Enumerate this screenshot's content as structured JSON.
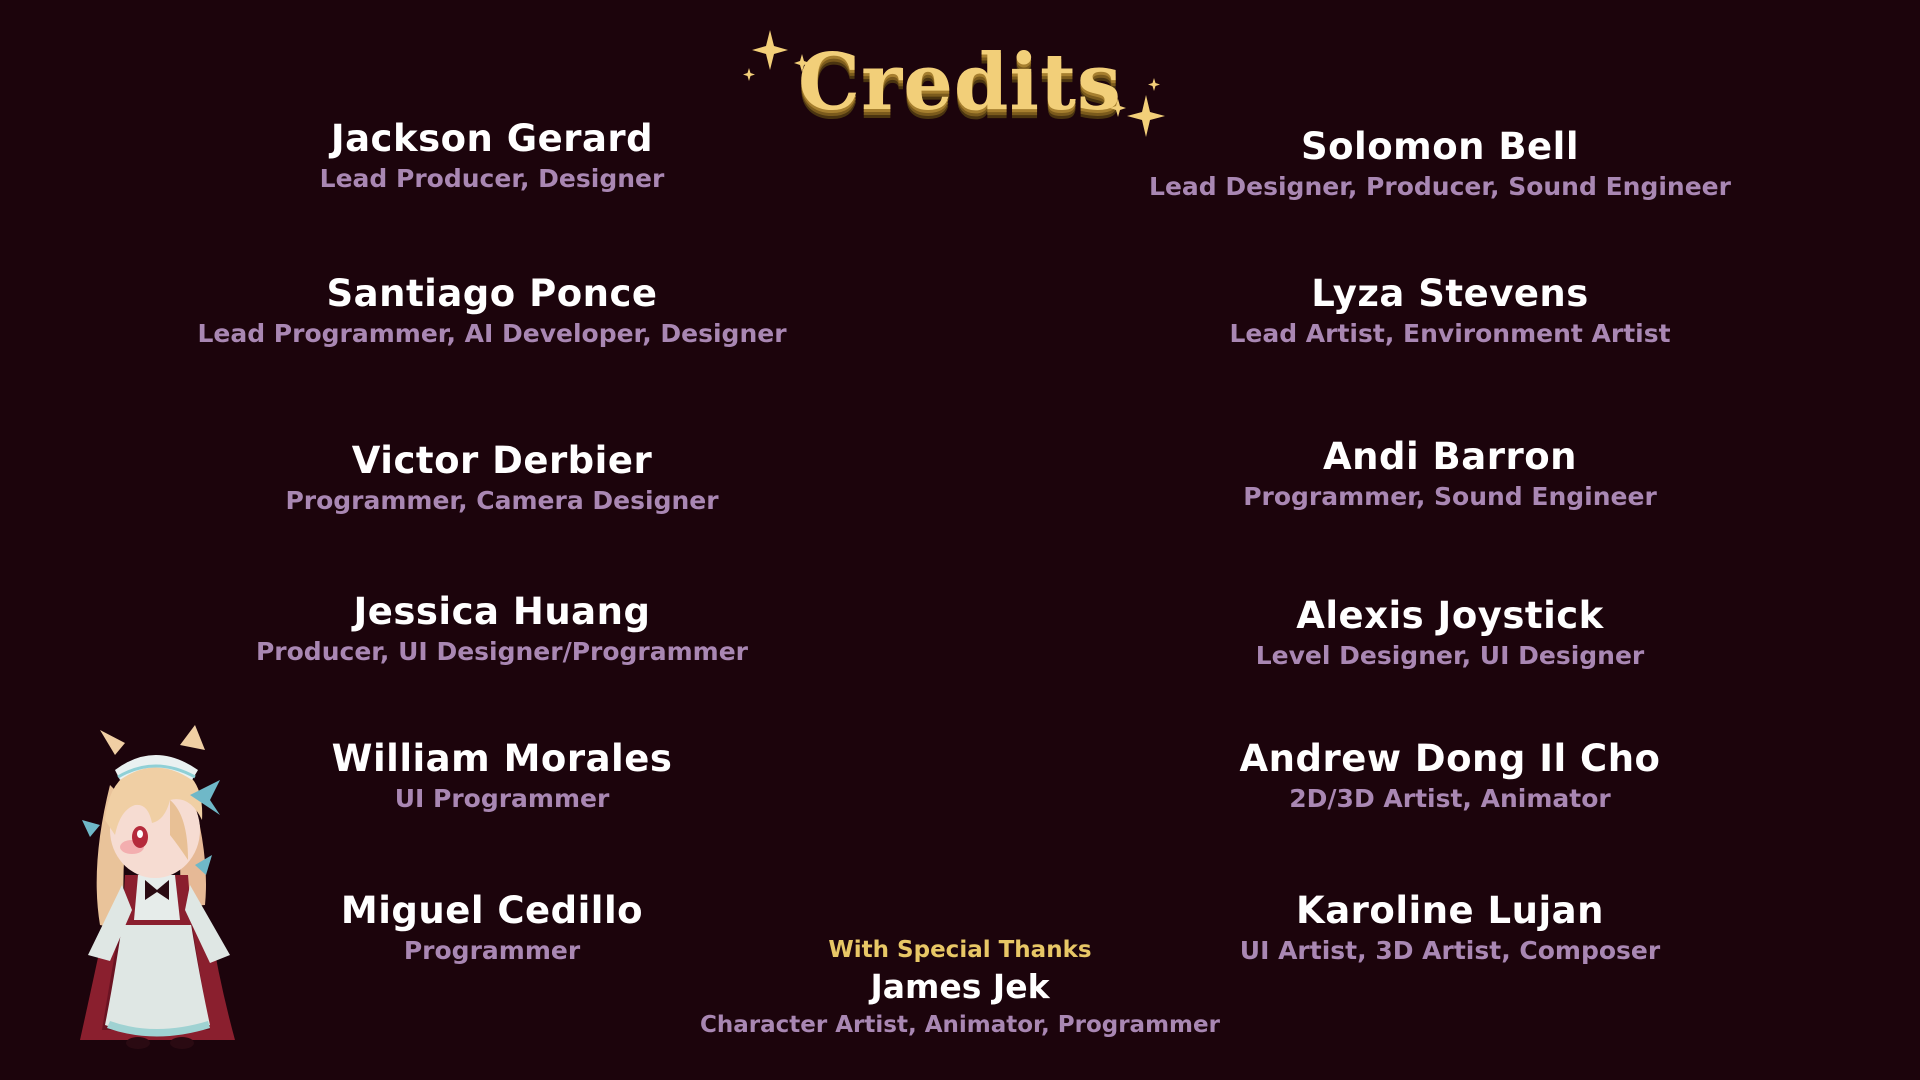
{
  "title": "Credits",
  "colors": {
    "background": "#1c040c",
    "title_gold": "#f2cf79",
    "name_white": "#ffffff",
    "role_purple": "#a987b3",
    "thanks_gold": "#e8c766"
  },
  "credits_left": [
    {
      "name": "Jackson Gerard",
      "role": "Lead Producer, Designer"
    },
    {
      "name": "Santiago Ponce",
      "role": "Lead Programmer, AI Developer, Designer"
    },
    {
      "name": "Victor Derbier",
      "role": "Programmer, Camera Designer"
    },
    {
      "name": "Jessica Huang",
      "role": "Producer, UI Designer/Programmer"
    },
    {
      "name": "William Morales",
      "role": "UI Programmer"
    },
    {
      "name": "Miguel Cedillo",
      "role": "Programmer"
    }
  ],
  "credits_right": [
    {
      "name": "Solomon Bell",
      "role": "Lead Designer, Producer, Sound Engineer"
    },
    {
      "name": "Lyza Stevens",
      "role": "Lead Artist, Environment Artist"
    },
    {
      "name": "Andi Barron",
      "role": "Programmer, Sound Engineer"
    },
    {
      "name": "Alexis Joystick",
      "role": "Level Designer, UI Designer"
    },
    {
      "name": "Andrew Dong Il Cho",
      "role": "2D/3D Artist, Animator"
    },
    {
      "name": "Karoline Lujan",
      "role": "UI Artist, 3D Artist, Composer"
    }
  ],
  "special_thanks": {
    "heading": "With Special Thanks",
    "name": "James Jek",
    "role": "Character Artist, Animator, Programmer"
  },
  "icons": {
    "sparkle_left": "sparkle-icon",
    "sparkle_right": "sparkle-icon",
    "character": "maid-character-sprite"
  }
}
